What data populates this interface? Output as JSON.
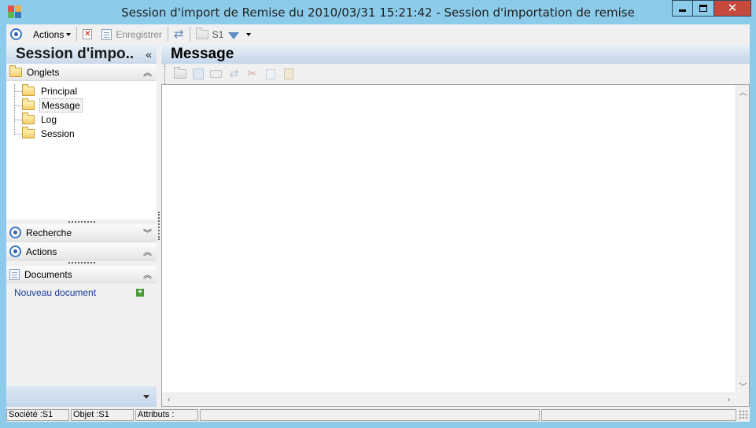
{
  "window": {
    "title": "Session d'import de Remise du 2010/03/31 15:21:42 -  Session d'importation de remise",
    "controls": {
      "minimize": "minimize",
      "maximize": "maximize",
      "close": "✕"
    }
  },
  "toolbar": {
    "actions_label": "Actions",
    "save_label": "Enregistrer",
    "company_label": "S1"
  },
  "left_panel": {
    "title": "Session d'impo..",
    "collapse_glyph": "«",
    "tabs_section": {
      "label": "Onglets",
      "items": [
        {
          "label": "Principal",
          "selected": false
        },
        {
          "label": "Message",
          "selected": true
        },
        {
          "label": "Log",
          "selected": false
        },
        {
          "label": "Session",
          "selected": false
        }
      ]
    },
    "search_section": {
      "label": "Recherche"
    },
    "actions_section": {
      "label": "Actions"
    },
    "documents_section": {
      "label": "Documents",
      "new_document": "Nouveau document"
    }
  },
  "right_panel": {
    "title": "Message"
  },
  "statusbar": {
    "company": "Société :S1",
    "object": "Objet :S1",
    "attributes": "Attributs :"
  },
  "colors": {
    "window_frame": "#8ccbea",
    "close_button": "#c7493d",
    "panel_header": "#c9d9ea",
    "link_text": "#1a3c9e"
  }
}
